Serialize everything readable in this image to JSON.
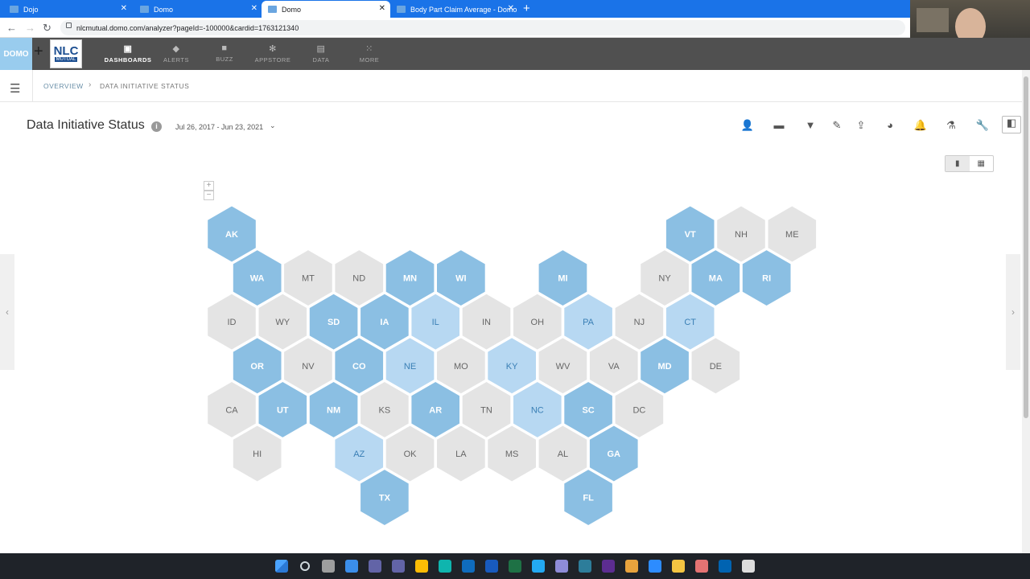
{
  "browser": {
    "tabs": [
      {
        "title": "Dojo",
        "active": false
      },
      {
        "title": "Domo",
        "active": false
      },
      {
        "title": "Domo",
        "active": true
      },
      {
        "title": "Body Part Claim Average - Domo",
        "active": false
      }
    ],
    "new_tab_glyph": "+",
    "close_glyph": "✕",
    "url": "nlcmutual.domo.com/analyzer?pageId=-100000&cardid=1763121340"
  },
  "appnav": {
    "logo_text": "DOMO",
    "plus_glyph": "+",
    "company_logo_big": "NLC",
    "company_logo_small": "MUTUAL",
    "items": [
      {
        "label": "DASHBOARDS",
        "icon": "dashboards-icon",
        "active": true
      },
      {
        "label": "ALERTS",
        "icon": "bell-icon",
        "active": false
      },
      {
        "label": "BUZZ",
        "icon": "chat-icon",
        "active": false
      },
      {
        "label": "APPSTORE",
        "icon": "appstore-icon",
        "active": false
      },
      {
        "label": "DATA",
        "icon": "database-icon",
        "active": false
      },
      {
        "label": "MORE",
        "icon": "grid-icon",
        "active": false
      }
    ]
  },
  "breadcrumb": {
    "root": "OVERVIEW",
    "current": "DATA INITIATIVE STATUS"
  },
  "card": {
    "title": "Data Initiative Status",
    "info_glyph": "i",
    "date_range": "Jul 26, 2017 - Jun 23, 2021"
  },
  "toolbar": [
    "share-user-icon",
    "comment-icon",
    "filter-icon",
    "edit-pencil-icon",
    "export-icon",
    "pie-chart-icon",
    "alert-bell-icon",
    "lab-flask-icon",
    "wrench-icon",
    "layout-panel-icon"
  ],
  "colors": {
    "status_dark": "#8bbfe3",
    "status_light": "#b7d8f2",
    "status_none": "#e4e4e4",
    "text_dark_bg": "#ffffff",
    "text_light_bg": "#3a7fb5",
    "text_none": "#666666"
  },
  "map": {
    "zoom_in": "+",
    "zoom_out": "−",
    "states": [
      {
        "abbr": "AK",
        "col": 0,
        "row": 0,
        "status": "dark"
      },
      {
        "abbr": "VT",
        "col": 9,
        "row": 0,
        "status": "dark"
      },
      {
        "abbr": "NH",
        "col": 10,
        "row": 0,
        "status": "none"
      },
      {
        "abbr": "ME",
        "col": 11,
        "row": 0,
        "status": "none"
      },
      {
        "abbr": "WA",
        "col": 0,
        "row": 1,
        "status": "dark"
      },
      {
        "abbr": "MT",
        "col": 1,
        "row": 1,
        "status": "none"
      },
      {
        "abbr": "ND",
        "col": 2,
        "row": 1,
        "status": "none"
      },
      {
        "abbr": "MN",
        "col": 3,
        "row": 1,
        "status": "dark"
      },
      {
        "abbr": "WI",
        "col": 4,
        "row": 1,
        "status": "dark"
      },
      {
        "abbr": "MI",
        "col": 6,
        "row": 1,
        "status": "dark"
      },
      {
        "abbr": "NY",
        "col": 8,
        "row": 1,
        "status": "none"
      },
      {
        "abbr": "MA",
        "col": 9,
        "row": 1,
        "status": "dark"
      },
      {
        "abbr": "RI",
        "col": 10,
        "row": 1,
        "status": "dark"
      },
      {
        "abbr": "ID",
        "col": 0,
        "row": 2,
        "status": "none"
      },
      {
        "abbr": "WY",
        "col": 1,
        "row": 2,
        "status": "none"
      },
      {
        "abbr": "SD",
        "col": 2,
        "row": 2,
        "status": "dark"
      },
      {
        "abbr": "IA",
        "col": 3,
        "row": 2,
        "status": "dark"
      },
      {
        "abbr": "IL",
        "col": 4,
        "row": 2,
        "status": "light"
      },
      {
        "abbr": "IN",
        "col": 5,
        "row": 2,
        "status": "none"
      },
      {
        "abbr": "OH",
        "col": 6,
        "row": 2,
        "status": "none"
      },
      {
        "abbr": "PA",
        "col": 7,
        "row": 2,
        "status": "light"
      },
      {
        "abbr": "NJ",
        "col": 8,
        "row": 2,
        "status": "none"
      },
      {
        "abbr": "CT",
        "col": 9,
        "row": 2,
        "status": "light"
      },
      {
        "abbr": "OR",
        "col": 0,
        "row": 3,
        "status": "dark"
      },
      {
        "abbr": "NV",
        "col": 1,
        "row": 3,
        "status": "none"
      },
      {
        "abbr": "CO",
        "col": 2,
        "row": 3,
        "status": "dark"
      },
      {
        "abbr": "NE",
        "col": 3,
        "row": 3,
        "status": "light"
      },
      {
        "abbr": "MO",
        "col": 4,
        "row": 3,
        "status": "none"
      },
      {
        "abbr": "KY",
        "col": 5,
        "row": 3,
        "status": "light"
      },
      {
        "abbr": "WV",
        "col": 6,
        "row": 3,
        "status": "none"
      },
      {
        "abbr": "VA",
        "col": 7,
        "row": 3,
        "status": "none"
      },
      {
        "abbr": "MD",
        "col": 8,
        "row": 3,
        "status": "dark"
      },
      {
        "abbr": "DE",
        "col": 9,
        "row": 3,
        "status": "none"
      },
      {
        "abbr": "CA",
        "col": 0,
        "row": 4,
        "status": "none"
      },
      {
        "abbr": "UT",
        "col": 1,
        "row": 4,
        "status": "dark"
      },
      {
        "abbr": "NM",
        "col": 2,
        "row": 4,
        "status": "dark"
      },
      {
        "abbr": "KS",
        "col": 3,
        "row": 4,
        "status": "none"
      },
      {
        "abbr": "AR",
        "col": 4,
        "row": 4,
        "status": "dark"
      },
      {
        "abbr": "TN",
        "col": 5,
        "row": 4,
        "status": "none"
      },
      {
        "abbr": "NC",
        "col": 6,
        "row": 4,
        "status": "light"
      },
      {
        "abbr": "SC",
        "col": 7,
        "row": 4,
        "status": "dark"
      },
      {
        "abbr": "DC",
        "col": 8,
        "row": 4,
        "status": "none"
      },
      {
        "abbr": "HI",
        "col": 0,
        "row": 5,
        "status": "none"
      },
      {
        "abbr": "AZ",
        "col": 2,
        "row": 5,
        "status": "light"
      },
      {
        "abbr": "OK",
        "col": 3,
        "row": 5,
        "status": "none"
      },
      {
        "abbr": "LA",
        "col": 4,
        "row": 5,
        "status": "none"
      },
      {
        "abbr": "MS",
        "col": 5,
        "row": 5,
        "status": "none"
      },
      {
        "abbr": "AL",
        "col": 6,
        "row": 5,
        "status": "none"
      },
      {
        "abbr": "GA",
        "col": 7,
        "row": 5,
        "status": "dark"
      },
      {
        "abbr": "TX",
        "col": 3,
        "row": 6,
        "status": "dark"
      },
      {
        "abbr": "FL",
        "col": 7,
        "row": 6,
        "status": "dark"
      }
    ]
  },
  "taskbar": [
    "windows-start-icon",
    "search-icon",
    "task-view-icon",
    "widgets-icon",
    "chat-icon",
    "teams-icon",
    "chrome-icon",
    "edge-icon",
    "outlook-icon",
    "word-icon",
    "excel-icon",
    "vscode-icon",
    "app-icon",
    "app-icon-2",
    "app-icon-3",
    "app-icon-4",
    "zoom-icon",
    "folder-icon",
    "app-icon-5",
    "app-icon-6",
    "app-icon-7"
  ]
}
